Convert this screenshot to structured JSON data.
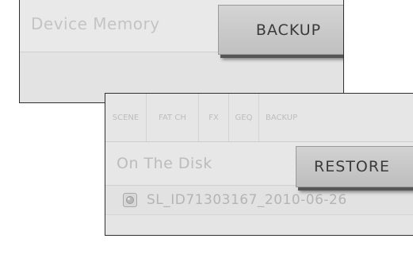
{
  "device_panel": {
    "title": "Device Memory",
    "backup_label": "BACKUP"
  },
  "disk_panel": {
    "tabs": [
      {
        "label": "SCENE"
      },
      {
        "label": "FAT CH"
      },
      {
        "label": "FX"
      },
      {
        "label": "GEQ"
      },
      {
        "label": "BACKUP"
      }
    ],
    "title": "On The Disk",
    "restore_label": "RESTORE",
    "files": [
      {
        "name": "SL_ID71303167_2010-06-26",
        "icon": "file-icon"
      }
    ]
  }
}
